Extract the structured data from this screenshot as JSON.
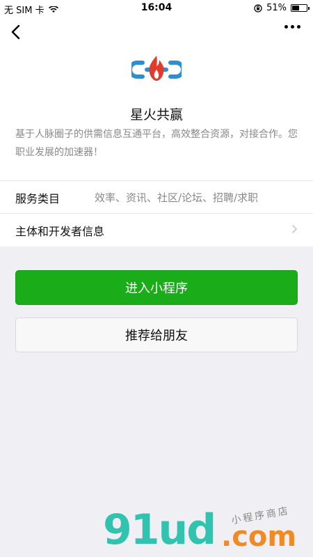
{
  "status_bar": {
    "carrier": "无 SIM 卡",
    "time": "16:04",
    "battery_percent": "51%",
    "battery_level": 0.51
  },
  "nav": {
    "back_icon": "chevron-left-icon",
    "more_icon": "ellipsis-icon"
  },
  "app": {
    "name": "星火共赢",
    "description": "基于人脉圈子的供需信息互通平台，高效整合资源，对接合作。您职业发展的加速器！"
  },
  "services": {
    "label": "服务类目",
    "value": "效率、资讯、社区/论坛、招聘/求职"
  },
  "developer": {
    "label": "主体和开发者信息"
  },
  "buttons": {
    "enter_label": "进入小程序",
    "recommend_label": "推荐给朋友"
  },
  "colors": {
    "primary_green": "#1aad19",
    "logo_blue": "#2b8fd0",
    "logo_red": "#e23b2e"
  },
  "watermark": {
    "main": "91ud",
    "dot": ".com",
    "sub": "小程序商店"
  }
}
